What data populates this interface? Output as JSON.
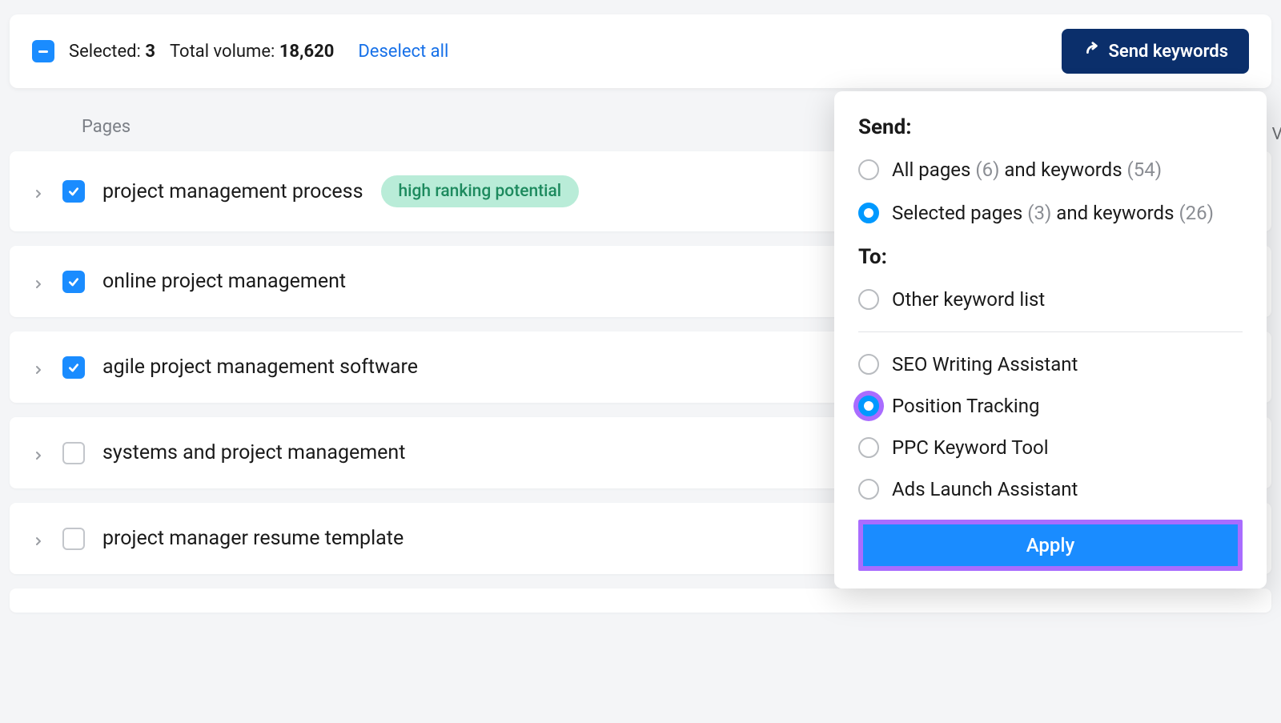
{
  "selection_bar": {
    "selected_label": "Selected:",
    "selected_count": "3",
    "total_label": "Total volume:",
    "total_value": "18,620",
    "deselect_label": "Deselect all",
    "send_button": "Send keywords"
  },
  "pages_header": "Pages",
  "pages": [
    {
      "label": "project management process",
      "checked": true,
      "badge": "high ranking potential"
    },
    {
      "label": "online project management",
      "checked": true,
      "badge": null
    },
    {
      "label": "agile project management software",
      "checked": true,
      "badge": null
    },
    {
      "label": "systems and project management",
      "checked": false,
      "badge": null
    },
    {
      "label": "project manager resume template",
      "checked": false,
      "badge": null
    }
  ],
  "panel": {
    "send_heading": "Send:",
    "send_options": [
      {
        "text_a": "All pages ",
        "count_a": "(6)",
        "text_b": " and keywords ",
        "count_b": "(54)",
        "selected": false
      },
      {
        "text_a": "Selected pages ",
        "count_a": "(3)",
        "text_b": " and keywords ",
        "count_b": "(26)",
        "selected": true
      }
    ],
    "to_heading": "To:",
    "to_first": {
      "label": "Other keyword list",
      "selected": false
    },
    "to_tools": [
      {
        "label": "SEO Writing Assistant",
        "selected": false,
        "highlight": false
      },
      {
        "label": "Position Tracking",
        "selected": true,
        "highlight": true
      },
      {
        "label": "PPC Keyword Tool",
        "selected": false,
        "highlight": false
      },
      {
        "label": "Ads Launch Assistant",
        "selected": false,
        "highlight": false
      }
    ],
    "apply_label": "Apply"
  },
  "peek_letter": "V"
}
